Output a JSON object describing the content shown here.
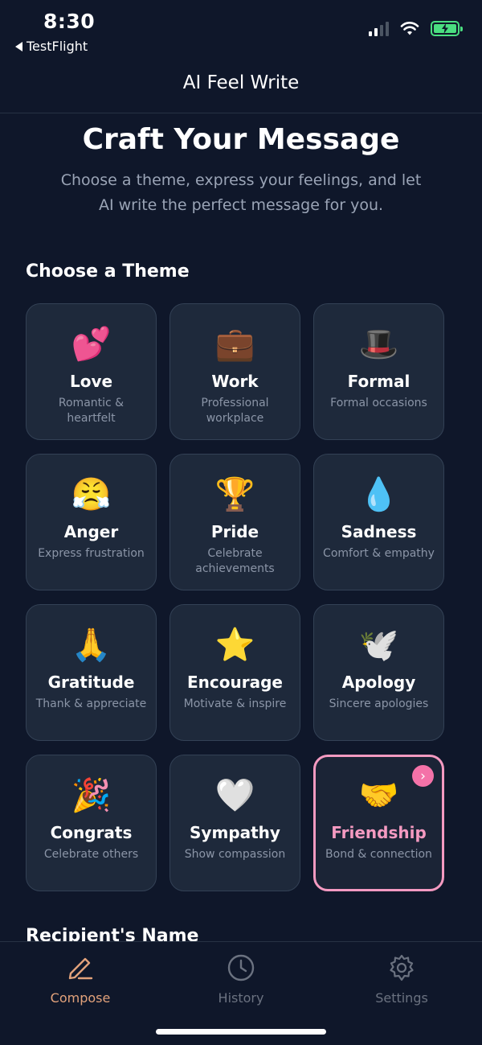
{
  "status_bar": {
    "time": "8:30",
    "back_app": "TestFlight"
  },
  "nav": {
    "title": "AI Feel Write"
  },
  "hero": {
    "title": "Craft Your Message",
    "subtitle": "Choose a theme, express your feelings, and let AI write the perfect message for you."
  },
  "theme_section": {
    "title": "Choose a Theme",
    "selected": "Friendship"
  },
  "themes": [
    {
      "emoji": "💕",
      "name": "Love",
      "desc": "Romantic & heartfelt"
    },
    {
      "emoji": "💼",
      "name": "Work",
      "desc": "Professional workplace"
    },
    {
      "emoji": "🎩",
      "name": "Formal",
      "desc": "Formal occasions"
    },
    {
      "emoji": "😤",
      "name": "Anger",
      "desc": "Express frustration"
    },
    {
      "emoji": "🏆",
      "name": "Pride",
      "desc": "Celebrate achievements"
    },
    {
      "emoji": "💧",
      "name": "Sadness",
      "desc": "Comfort & empathy"
    },
    {
      "emoji": "🙏",
      "name": "Gratitude",
      "desc": "Thank & appreciate"
    },
    {
      "emoji": "⭐",
      "name": "Encourage",
      "desc": "Motivate & inspire"
    },
    {
      "emoji": "🕊️",
      "name": "Apology",
      "desc": "Sincere apologies"
    },
    {
      "emoji": "🎉",
      "name": "Congrats",
      "desc": "Celebrate others"
    },
    {
      "emoji": "🤍",
      "name": "Sympathy",
      "desc": "Show compassion"
    },
    {
      "emoji": "🤝",
      "name": "Friendship",
      "desc": "Bond & connection"
    }
  ],
  "recipient_section": {
    "title": "Recipient's Name"
  },
  "tabs": [
    {
      "label": "Compose",
      "icon": "pencil-icon",
      "active": true
    },
    {
      "label": "History",
      "icon": "clock-icon",
      "active": false
    },
    {
      "label": "Settings",
      "icon": "gear-icon",
      "active": false
    }
  ],
  "colors": {
    "background": "#0f172a",
    "card": "#1e293b",
    "accent_pink": "#f472a8",
    "accent_tab": "#e2a27b"
  }
}
